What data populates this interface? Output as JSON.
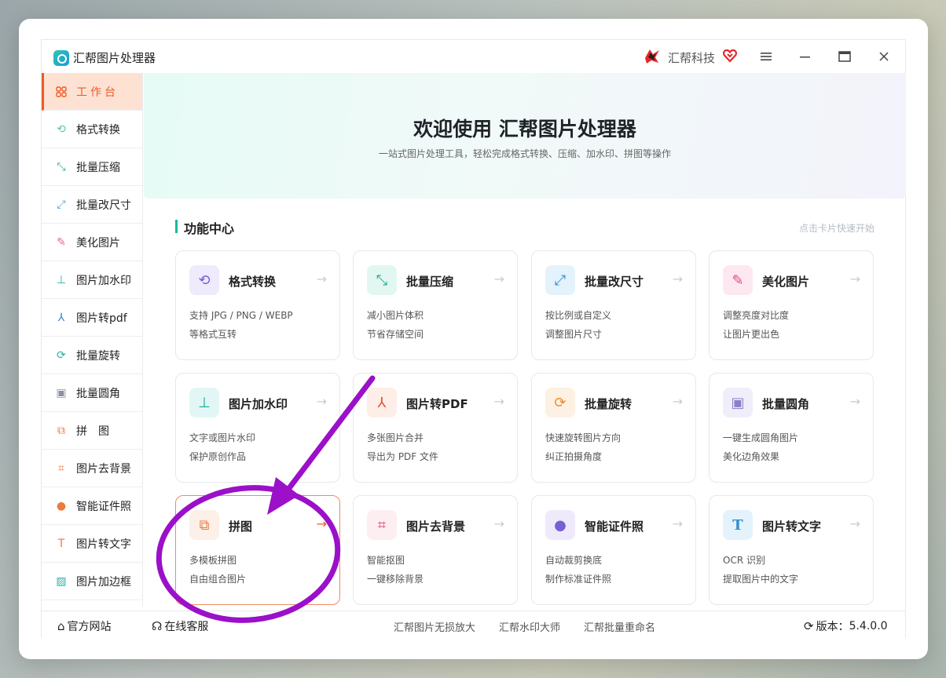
{
  "app": {
    "title": "汇帮图片处理器",
    "brand": "汇帮科技"
  },
  "colors": {
    "accent": "#ee5a24",
    "teal": "#1cb79e",
    "annotation": "#9b10c8"
  },
  "sidebar": {
    "items": [
      {
        "label": "工作台",
        "icon": "grid-icon"
      },
      {
        "label": "格式转换",
        "icon": "convert-icon"
      },
      {
        "label": "批量压缩",
        "icon": "compress-icon"
      },
      {
        "label": "批量改尺寸",
        "icon": "resize-icon"
      },
      {
        "label": "美化图片",
        "icon": "beautify-icon"
      },
      {
        "label": "图片加水印",
        "icon": "watermark-icon"
      },
      {
        "label": "图片转pdf",
        "icon": "pdf-icon"
      },
      {
        "label": "批量旋转",
        "icon": "rotate-icon"
      },
      {
        "label": "批量圆角",
        "icon": "round-corner-icon"
      },
      {
        "label": "拼　图",
        "icon": "collage-icon"
      },
      {
        "label": "图片去背景",
        "icon": "crop-icon"
      },
      {
        "label": "智能证件照",
        "icon": "person-icon"
      },
      {
        "label": "图片转文字",
        "icon": "text-icon"
      },
      {
        "label": "图片加边框",
        "icon": "frame-icon"
      }
    ]
  },
  "hero": {
    "title": "欢迎使用 汇帮图片处理器",
    "subtitle": "一站式图片处理工具，轻松完成格式转换、压缩、加水印、拼图等操作"
  },
  "section": {
    "title": "功能中心",
    "hint": "点击卡片快速开始"
  },
  "cards": [
    {
      "title": "格式转换",
      "desc1": "支持 JPG / PNG / WEBP",
      "desc2": "等格式互转",
      "arrow": "→"
    },
    {
      "title": "批量压缩",
      "desc1": "减小图片体积",
      "desc2": "节省存储空间",
      "arrow": "→"
    },
    {
      "title": "批量改尺寸",
      "desc1": "按比例或自定义",
      "desc2": "调整图片尺寸",
      "arrow": "→"
    },
    {
      "title": "美化图片",
      "desc1": "调整亮度对比度",
      "desc2": "让图片更出色",
      "arrow": "→"
    },
    {
      "title": "图片加水印",
      "desc1": "文字或图片水印",
      "desc2": "保护原创作品",
      "arrow": "→"
    },
    {
      "title": "图片转PDF",
      "desc1": "多张图片合并",
      "desc2": "导出为 PDF 文件",
      "arrow": "→"
    },
    {
      "title": "批量旋转",
      "desc1": "快速旋转图片方向",
      "desc2": "纠正拍摄角度",
      "arrow": "→"
    },
    {
      "title": "批量圆角",
      "desc1": "一键生成圆角图片",
      "desc2": "美化边角效果",
      "arrow": "→"
    },
    {
      "title": "拼图",
      "desc1": "多模板拼图",
      "desc2": "自由组合图片",
      "arrow": "→"
    },
    {
      "title": "图片去背景",
      "desc1": "智能抠图",
      "desc2": "一键移除背景",
      "arrow": "→"
    },
    {
      "title": "智能证件照",
      "desc1": "自动裁剪换底",
      "desc2": "制作标准证件照",
      "arrow": "→"
    },
    {
      "title": "图片转文字",
      "desc1": "OCR 识别",
      "desc2": "提取图片中的文字",
      "arrow": "→"
    }
  ],
  "footer": {
    "website": "官方网站",
    "support": "在线客服",
    "links": [
      "汇帮图片无损放大",
      "汇帮水印大师",
      "汇帮批量重命名"
    ],
    "version_label": "版本：",
    "version": "5.4.0.0"
  }
}
